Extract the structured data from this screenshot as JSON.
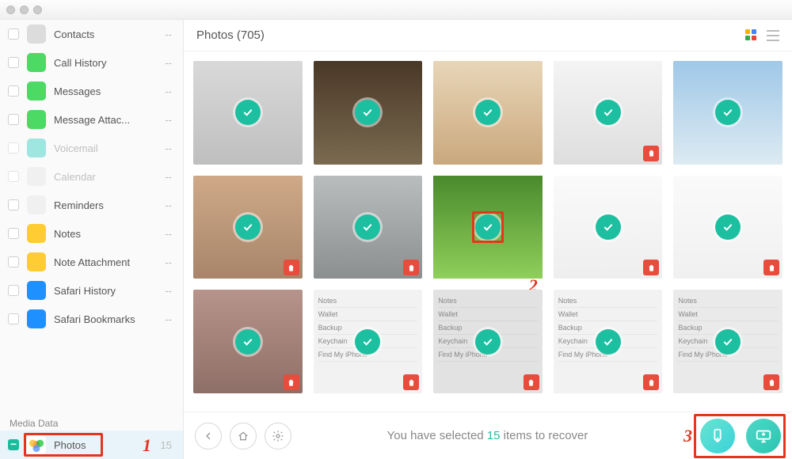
{
  "header": {
    "title": "Photos (705)"
  },
  "sidebar": {
    "items": [
      {
        "key": "contacts",
        "label": "Contacts",
        "count": "--",
        "color": "#dcdcdc",
        "disabled": false
      },
      {
        "key": "call-history",
        "label": "Call History",
        "count": "--",
        "color": "#4cd964",
        "disabled": false
      },
      {
        "key": "messages",
        "label": "Messages",
        "count": "--",
        "color": "#4cd964",
        "disabled": false
      },
      {
        "key": "message-attachments",
        "label": "Message Attac...",
        "count": "--",
        "color": "#4cd964",
        "disabled": false
      },
      {
        "key": "voicemail",
        "label": "Voicemail",
        "count": "--",
        "color": "#9fe6e0",
        "disabled": true
      },
      {
        "key": "calendar",
        "label": "Calendar",
        "count": "--",
        "color": "#f0f0f0",
        "disabled": true
      },
      {
        "key": "reminders",
        "label": "Reminders",
        "count": "--",
        "color": "#f0f0f0",
        "disabled": false
      },
      {
        "key": "notes",
        "label": "Notes",
        "count": "--",
        "color": "#ffcc33",
        "disabled": false
      },
      {
        "key": "note-attachment",
        "label": "Note Attachment",
        "count": "--",
        "color": "#ffcc33",
        "disabled": false
      },
      {
        "key": "safari-history",
        "label": "Safari History",
        "count": "--",
        "color": "#1e90ff",
        "disabled": false
      },
      {
        "key": "safari-bookmarks",
        "label": "Safari Bookmarks",
        "count": "--",
        "color": "#1e90ff",
        "disabled": false
      }
    ],
    "media_header": "Media Data",
    "photos": {
      "label": "Photos",
      "count": "15"
    }
  },
  "grid": {
    "thumbs": [
      {
        "id": 1,
        "trash": false,
        "cls": "p1"
      },
      {
        "id": 2,
        "trash": false,
        "cls": "p2"
      },
      {
        "id": 3,
        "trash": false,
        "cls": "p3"
      },
      {
        "id": 4,
        "trash": true,
        "cls": "p4"
      },
      {
        "id": 5,
        "trash": false,
        "cls": "p5"
      },
      {
        "id": 6,
        "trash": true,
        "cls": "p6"
      },
      {
        "id": 7,
        "trash": true,
        "cls": "p7"
      },
      {
        "id": 8,
        "trash": false,
        "cls": "p8",
        "highlight": true
      },
      {
        "id": 9,
        "trash": true,
        "cls": "p9"
      },
      {
        "id": 10,
        "trash": true,
        "cls": "p10"
      },
      {
        "id": 11,
        "trash": true,
        "cls": "p11"
      },
      {
        "id": 12,
        "trash": true,
        "cls": "p12",
        "settings": true
      },
      {
        "id": 13,
        "trash": true,
        "cls": "p13",
        "settings": true
      },
      {
        "id": 14,
        "trash": true,
        "cls": "p14",
        "settings": true
      },
      {
        "id": 15,
        "trash": true,
        "cls": "p15",
        "settings": true
      }
    ],
    "settings_lines": [
      "Notes",
      "Wallet",
      "Backup",
      "Keychain",
      "Find My iPhone"
    ]
  },
  "footer": {
    "status_prefix": "You have selected ",
    "status_count": "15",
    "status_suffix": " items to recover"
  },
  "annotations": {
    "one": "1",
    "two": "2",
    "three": "3"
  }
}
